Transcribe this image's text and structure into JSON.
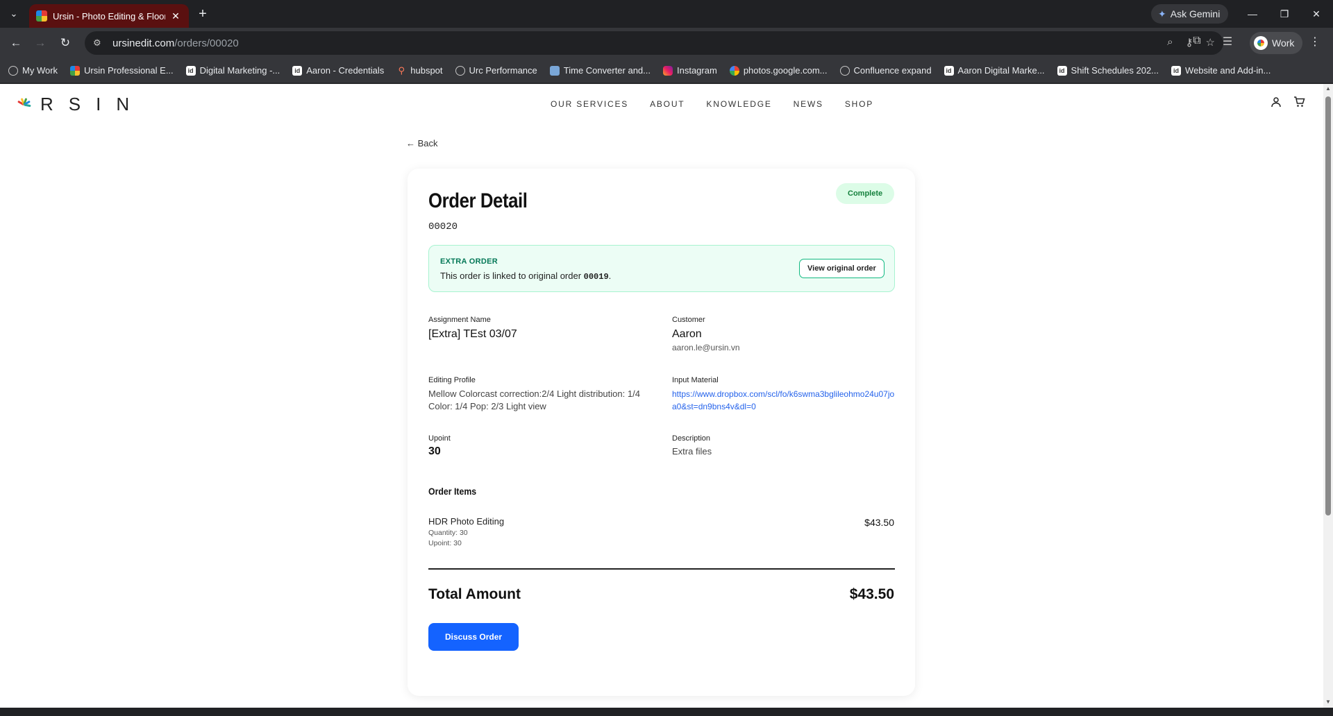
{
  "browser": {
    "tab_title": "Ursin - Photo Editing & Floor Pl",
    "ask_gemini": "Ask Gemini",
    "url_host": "ursinedit.com",
    "url_path": "/orders/00020",
    "profile_name": "Work",
    "bookmarks": [
      {
        "label": "My Work",
        "icon": "globe"
      },
      {
        "label": "Ursin Professional E...",
        "icon": "ursin"
      },
      {
        "label": "Digital Marketing -...",
        "icon": "doc"
      },
      {
        "label": "Aaron - Credentials",
        "icon": "doc"
      },
      {
        "label": "hubspot",
        "icon": "hub"
      },
      {
        "label": "Urc Performance",
        "icon": "globe"
      },
      {
        "label": "Time Converter and...",
        "icon": "time"
      },
      {
        "label": "Instagram",
        "icon": "insta"
      },
      {
        "label": "photos.google.com...",
        "icon": "photos"
      },
      {
        "label": "Confluence expand",
        "icon": "globe"
      },
      {
        "label": "Aaron Digital Marke...",
        "icon": "doc"
      },
      {
        "label": "Shift Schedules 202...",
        "icon": "doc"
      },
      {
        "label": "Website and Add-in...",
        "icon": "doc"
      }
    ]
  },
  "site": {
    "logo_text": "RSIN",
    "nav": [
      "OUR SERVICES",
      "ABOUT",
      "KNOWLEDGE",
      "NEWS",
      "SHOP"
    ]
  },
  "page": {
    "back_label": "← Back",
    "title": "Order Detail",
    "order_id": "00020",
    "status": "Complete",
    "extra": {
      "label": "EXTRA ORDER",
      "text_before": "This order is linked to original order ",
      "original_id": "00019",
      "text_after": ".",
      "button": "View original order"
    },
    "fields": {
      "assignment_label": "Assignment Name",
      "assignment_value": "[Extra] TEst 03/07",
      "customer_label": "Customer",
      "customer_name": "Aaron",
      "customer_email": "aaron.le@ursin.vn",
      "profile_label": "Editing Profile",
      "profile_value": "Mellow Colorcast correction:2/4 Light distribution: 1/4 Color: 1/4 Pop: 2/3 Light view",
      "input_label": "Input Material",
      "input_value": "https://www.dropbox.com/scl/fo/k6swma3bglileohmo24u07joa0&st=dn9bns4v&dl=0",
      "upoint_label": "Upoint",
      "upoint_value": "30",
      "description_label": "Description",
      "description_value": "Extra files"
    },
    "items_title": "Order Items",
    "items": [
      {
        "name": "HDR Photo Editing",
        "quantity": "Quantity: 30",
        "upoint": "Upoint: 30",
        "price": "$43.50"
      }
    ],
    "total_label": "Total Amount",
    "total_value": "$43.50",
    "discuss_button": "Discuss Order"
  }
}
